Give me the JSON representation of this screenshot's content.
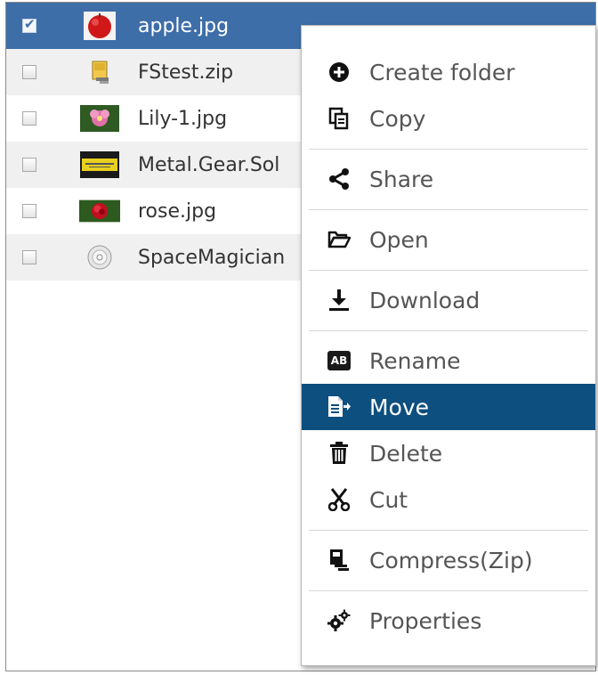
{
  "files": [
    {
      "name": "apple.jpg",
      "checked": true,
      "icon": "apple-thumbnail"
    },
    {
      "name": "FStest.zip",
      "checked": false,
      "icon": "zip-archive-icon"
    },
    {
      "name": "Lily-1.jpg",
      "checked": false,
      "icon": "lily-thumbnail"
    },
    {
      "name": "Metal.Gear.Sol",
      "checked": false,
      "icon": "metal-gear-thumbnail"
    },
    {
      "name": "rose.jpg",
      "checked": false,
      "icon": "rose-thumbnail"
    },
    {
      "name": "SpaceMagician",
      "checked": false,
      "icon": "disc-icon"
    }
  ],
  "menu": {
    "create_folder": "Create folder",
    "copy": "Copy",
    "share": "Share",
    "open": "Open",
    "download": "Download",
    "rename": "Rename",
    "rename_icon_text": "AB",
    "move": "Move",
    "delete": "Delete",
    "cut": "Cut",
    "compress": "Compress(Zip)",
    "properties": "Properties"
  },
  "colors": {
    "selected_row": "#3e6ea8",
    "menu_highlight": "#0d4f7e"
  }
}
